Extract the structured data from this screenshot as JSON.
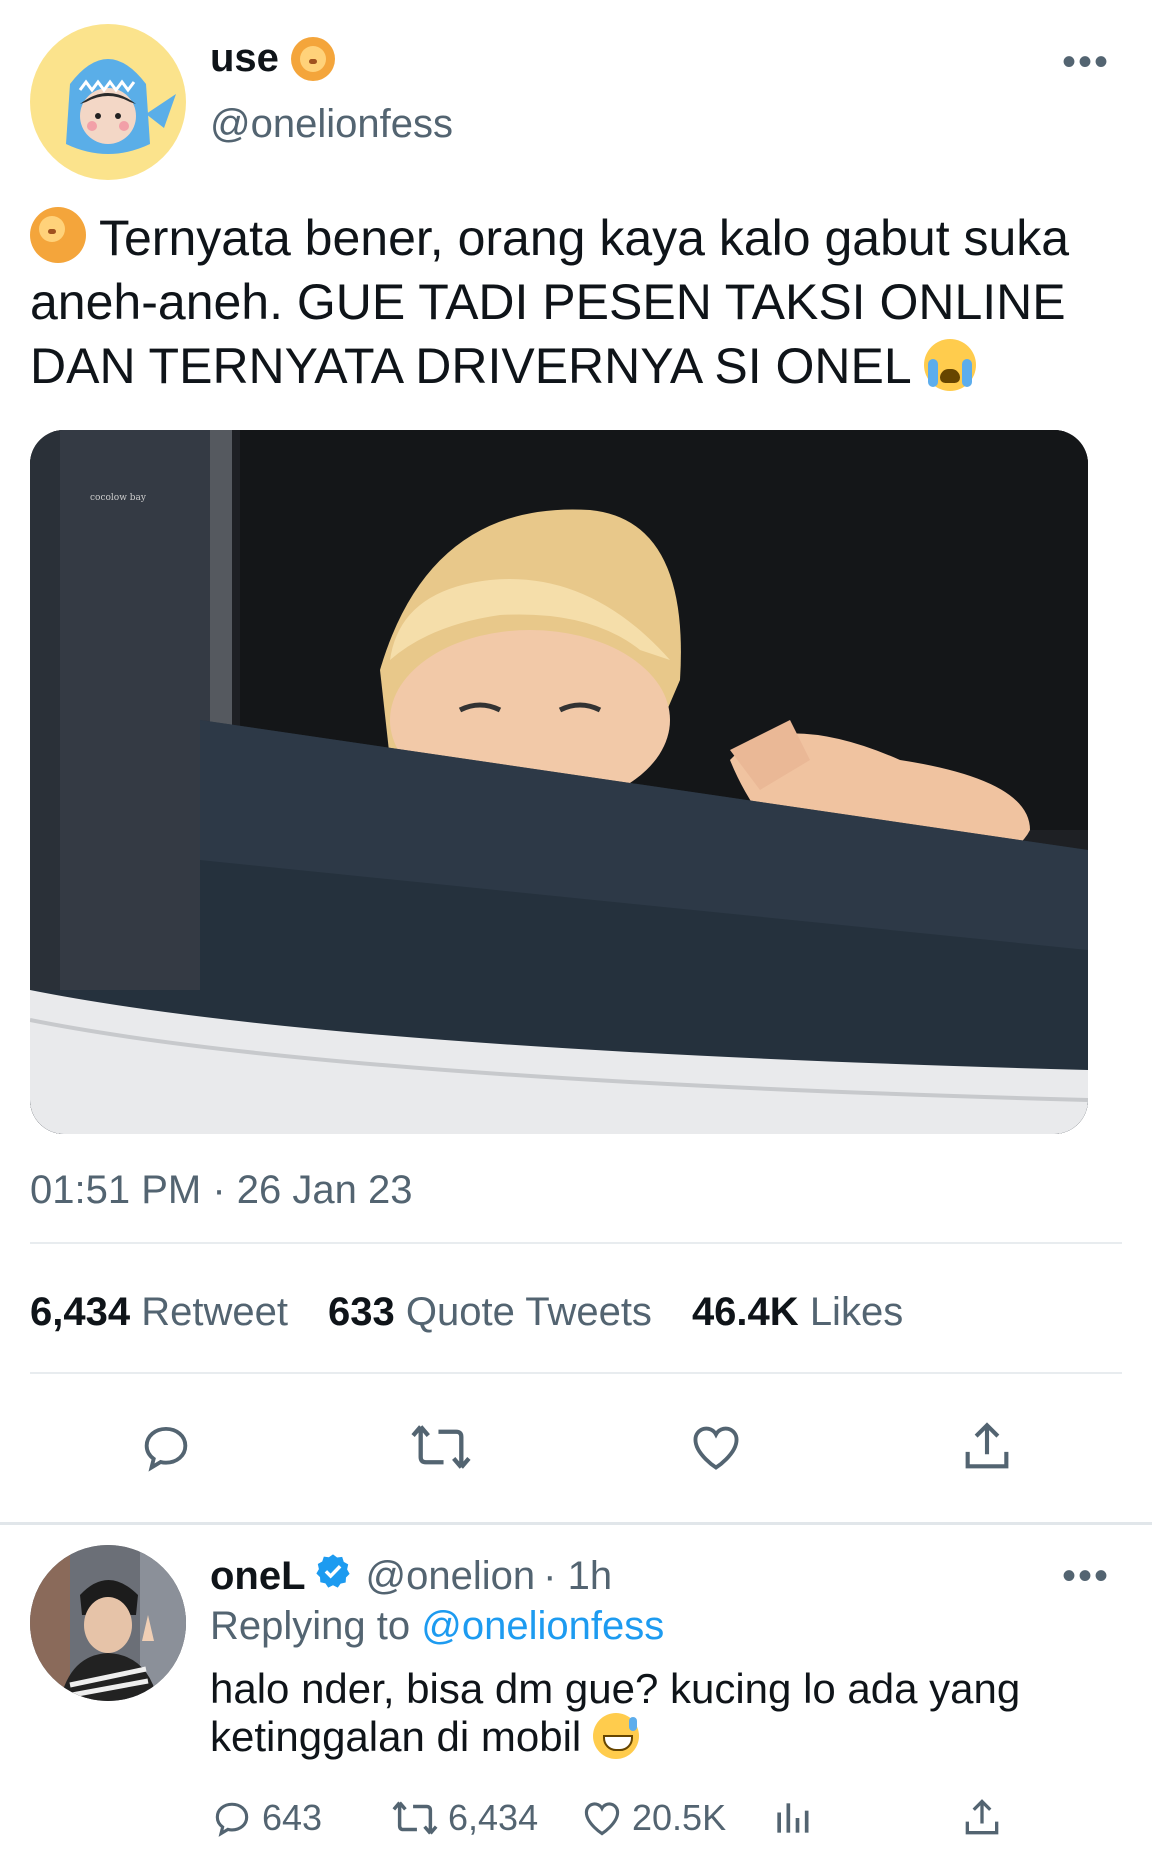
{
  "tweet": {
    "display_name": "use",
    "handle": "@onelionfess",
    "text": "Ternyata bener, orang kaya kalo gabut suka aneh-aneh. GUE TADI PESEN TAKSI ONLINE DAN TERNYATA DRIVERNYA SI ONEL",
    "timestamp": "01:51 PM · 26 Jan 23",
    "stats": {
      "retweets_count": "6,434",
      "retweets_label": "Retweet",
      "quotes_count": "633",
      "quotes_label": "Quote Tweets",
      "likes_count": "46.4K",
      "likes_label": "Likes"
    },
    "more_label": "•••"
  },
  "reply": {
    "display_name": "oneL",
    "handle": "@onelion",
    "time": "· 1h",
    "replying_prefix": "Replying to",
    "replying_handle": "@onelionfess",
    "text": "halo nder, bisa dm gue? kucing lo ada yang ketinggalan di mobil",
    "more_label": "•••",
    "counts": {
      "replies": "643",
      "retweets": "6,434",
      "likes": "20.5K"
    }
  },
  "colors": {
    "accent": "#1d9bf0",
    "secondary_text": "#536471",
    "verified": "#1d9bf0"
  },
  "icons": [
    "lion-emoji-icon",
    "crying-emoji-icon",
    "reply-icon",
    "retweet-icon",
    "like-icon",
    "share-icon",
    "verified-badge-icon",
    "analytics-icon",
    "sweat-smile-emoji-icon",
    "more-icon"
  ]
}
